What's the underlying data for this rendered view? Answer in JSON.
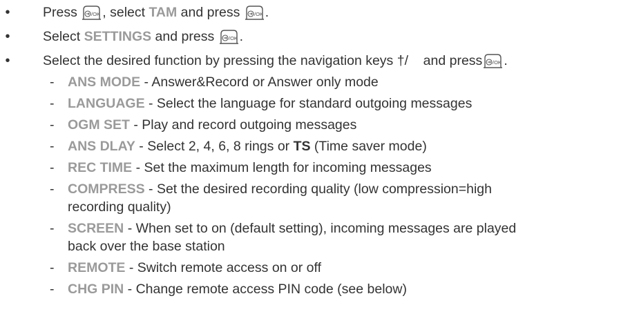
{
  "bullets": [
    {
      "t1": "Press ",
      "t2": ", select ",
      "kw": "TAM",
      "t3": " and press ",
      "t4": "."
    },
    {
      "t1": "Select ",
      "kw": "SETTINGS",
      "t2": "  and press ",
      "t3": "."
    },
    {
      "t1": "Select the desired function by pressing the navigation keys †/",
      "t2": "    and press",
      "t3": "."
    }
  ],
  "items": [
    {
      "kw": "ANS MODE",
      "text": " - Answer&Record or Answer only mode"
    },
    {
      "kw": "LANGUAGE",
      "text": " - Select the language for standard outgoing messages"
    },
    {
      "kw": "OGM SET",
      "text": " - Play and record outgoing messages"
    },
    {
      "kw": "ANS DLAY",
      "text": " - Select 2, 4, 6, 8 rings or ",
      "bold": "TS",
      "text2": " (Time saver mode)"
    },
    {
      "kw": "REC TIME",
      "text": " - Set the maximum length for incoming messages"
    },
    {
      "kw": "COMPRESS",
      "text": " - Set the desired recording quality (low compression=high",
      "cont": "recording quality)"
    },
    {
      "kw": "SCREEN",
      "text": " - When set to on (default setting), incoming messages are played",
      "cont": "back over the base station"
    },
    {
      "kw": "REMOTE",
      "text": " - Switch remote access on or off"
    },
    {
      "kw": "CHG PIN",
      "text": " - Change remote access PIN code (see below)"
    }
  ],
  "dash": "-",
  "bullet_char": "•",
  "icons": {
    "ok_button": "menu-ok-key-icon"
  }
}
